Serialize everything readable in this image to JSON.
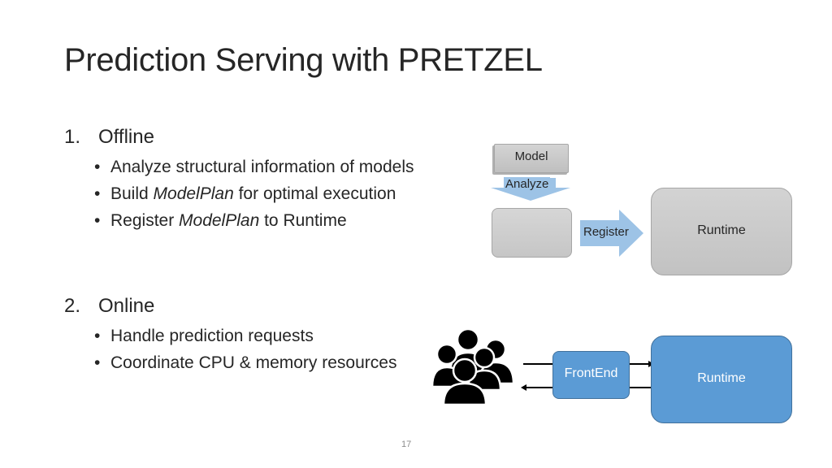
{
  "slide": {
    "title": "Prediction Serving with PRETZEL",
    "page_number": "17"
  },
  "sections": [
    {
      "number": "1.",
      "heading": "Offline",
      "bullets": [
        {
          "pre": "Analyze structural information of models",
          "em": "",
          "post": ""
        },
        {
          "pre": "Build ",
          "em": "ModelPlan",
          "post": " for optimal execution"
        },
        {
          "pre": "Register ",
          "em": "ModelPlan",
          "post": " to Runtime"
        }
      ]
    },
    {
      "number": "2.",
      "heading": "Online",
      "bullets": [
        {
          "pre": "Handle prediction requests",
          "em": "",
          "post": ""
        },
        {
          "pre": "Coordinate CPU & memory resources",
          "em": "",
          "post": ""
        }
      ]
    }
  ],
  "diagram": {
    "offline": {
      "model_label": "Model",
      "analyze_label": "Analyze",
      "register_label": "Register",
      "runtime_label": "Runtime"
    },
    "online": {
      "users_icon": "users-group-icon",
      "frontend_label": "FrontEnd",
      "runtime_label": "Runtime"
    },
    "colors": {
      "blue_fill": "#5b9bd5",
      "light_blue_arrow": "#9dc3e6",
      "gray_fill": "#c8c8c8"
    }
  }
}
